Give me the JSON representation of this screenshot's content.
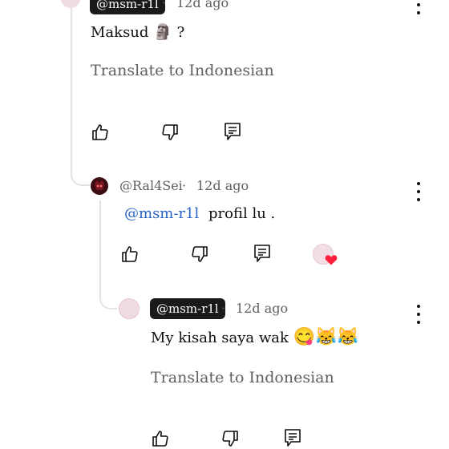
{
  "comments": [
    {
      "handle": "@msm-r1l",
      "time": "12d ago",
      "text": "Maksud",
      "text_suffix": "?",
      "inline_emoji": "🗿",
      "translate": "Translate to Indonesian",
      "icons": {
        "like": "thumb-up-icon",
        "dislike": "thumb-down-icon",
        "reply": "reply-icon",
        "more": "more-vert-icon"
      }
    },
    {
      "handle": "@Ral4Sei",
      "time": "12d ago",
      "mention": "@msm-r1l",
      "text": "profil lu .",
      "icons": {
        "like": "thumb-up-icon",
        "dislike": "thumb-down-icon",
        "reply": "reply-icon",
        "more": "more-vert-icon",
        "creator_heart": "creator-heart-icon"
      }
    },
    {
      "handle": "@msm-r1l",
      "time": "12d ago",
      "text": "My kisah saya wak",
      "emojis": "😋😹😹",
      "translate": "Translate to Indonesian",
      "icons": {
        "like": "thumb-up-icon",
        "dislike": "thumb-down-icon",
        "reply": "reply-icon",
        "more": "more-vert-icon"
      }
    }
  ],
  "separator": "·",
  "colors": {
    "chip_bg": "#1a1a1a",
    "mention": "#2a63c8",
    "heart": "#ff1f3d",
    "thread_line": "#e3e3e3"
  }
}
